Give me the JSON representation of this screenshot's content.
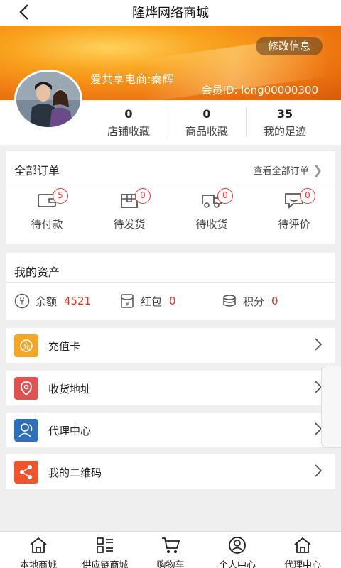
{
  "header": {
    "title": "隆烨网络商城",
    "back_icon": "back-arrow-icon"
  },
  "profile": {
    "edit_label": "修改信息",
    "username": "爱共享电商:秦辉",
    "member_id": "会员ID: long00000300",
    "stats": [
      {
        "value": "0",
        "label": "店铺收藏"
      },
      {
        "value": "0",
        "label": "商品收藏"
      },
      {
        "value": "35",
        "label": "我的足迹"
      }
    ]
  },
  "orders": {
    "title": "全部订单",
    "view_all": "查看全部订单",
    "items": [
      {
        "label": "待付款",
        "count": "5",
        "icon": "wallet-icon"
      },
      {
        "label": "待发货",
        "count": "0",
        "icon": "package-icon"
      },
      {
        "label": "待收货",
        "count": "0",
        "icon": "truck-icon"
      },
      {
        "label": "待评价",
        "count": "0",
        "icon": "comment-icon"
      }
    ]
  },
  "assets": {
    "title": "我的资产",
    "items": [
      {
        "label": "余额",
        "value": "4521",
        "icon": "yen-icon"
      },
      {
        "label": "红包",
        "value": "0",
        "icon": "red-packet-icon"
      },
      {
        "label": "积分",
        "value": "0",
        "icon": "coins-icon"
      }
    ]
  },
  "menu": [
    {
      "label": "充值卡",
      "icon": "recharge-card-icon",
      "color": "#f5a623"
    },
    {
      "label": "收货地址",
      "icon": "location-pin-icon",
      "color": "#e05252"
    },
    {
      "label": "代理中心",
      "icon": "agent-user-icon",
      "color": "#2f6fb8"
    },
    {
      "label": "我的二维码",
      "icon": "share-icon",
      "color": "#f0542d"
    }
  ],
  "tabbar": [
    {
      "label": "本地商城",
      "icon": "home-icon"
    },
    {
      "label": "供应链商城",
      "icon": "list-grid-icon"
    },
    {
      "label": "购物车",
      "icon": "cart-icon"
    },
    {
      "label": "个人中心",
      "icon": "user-circle-icon"
    },
    {
      "label": "代理中心",
      "icon": "home-icon"
    }
  ],
  "colors": {
    "accent": "#f07a12",
    "badge": "#e33333",
    "value_red": "#d32f2f"
  }
}
